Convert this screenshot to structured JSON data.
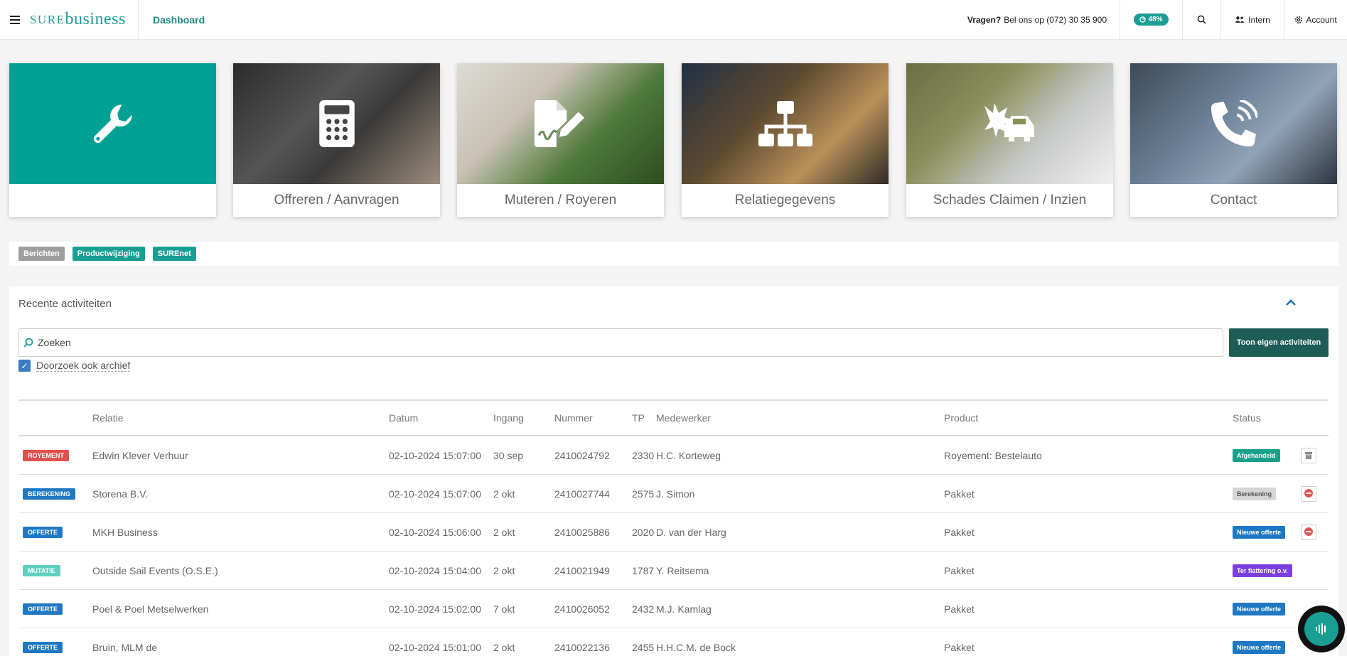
{
  "header": {
    "logo_sure": "SURE",
    "logo_business": "business",
    "breadcrumb": "Dashboard",
    "vragen_label": "Vragen?",
    "vragen_text": "Bel ons op (072) 30 35 900",
    "progress_badge": "48%",
    "intern_label": "Intern",
    "account_label": "Account"
  },
  "tiles": [
    {
      "label": "",
      "icon": "wrench-icon",
      "color": "#00a095"
    },
    {
      "label": "Offreren / Aanvragen",
      "icon": "calculator-icon"
    },
    {
      "label": "Muteren / Royeren",
      "icon": "file-signature-icon"
    },
    {
      "label": "Relatiegegevens",
      "icon": "network-icon"
    },
    {
      "label": "Schades Claimen / Inzien",
      "icon": "car-crash-icon"
    },
    {
      "label": "Contact",
      "icon": "phone-volume-icon"
    }
  ],
  "tags": [
    {
      "label": "Berichten",
      "color": "#9e9e9e"
    },
    {
      "label": "Productwijziging",
      "color": "#1a9e94"
    },
    {
      "label": "SUREnet",
      "color": "#1a9e94"
    }
  ],
  "activities": {
    "title": "Recente activiteiten",
    "search_placeholder": "Zoeken",
    "own_button": "Toon eigen activiteiten",
    "archive_label": "Doorzoek ook archief",
    "columns": [
      "Relatie",
      "Datum",
      "Ingang",
      "Nummer",
      "TP",
      "Medewerker",
      "Product",
      "Status"
    ],
    "rows": [
      {
        "type": "ROYEMENT",
        "type_color": "#e0504f",
        "relatie": "Edwin Klever Verhuur",
        "datum": "02-10-2024 15:07:00",
        "ingang": "30 sep",
        "nummer": "2410024792",
        "tp": "2330",
        "medewerker": "H.C. Korteweg",
        "product": "Royement: Bestelauto",
        "status": "Afgehandeld",
        "status_color": "#1aa08a",
        "status_text_color": "#ffffff",
        "action": "archive-icon"
      },
      {
        "type": "BEREKENING",
        "type_color": "#1f78c1",
        "relatie": "Storena B.V.",
        "datum": "02-10-2024 15:07:00",
        "ingang": "2 okt",
        "nummer": "2410027744",
        "tp": "2575",
        "medewerker": "J. Simon",
        "product": "Pakket",
        "status": "Berekening",
        "status_color": "#d6d6d6",
        "status_text_color": "#555555",
        "action": "remove-icon"
      },
      {
        "type": "OFFERTE",
        "type_color": "#1f78c1",
        "relatie": "MKH Business",
        "datum": "02-10-2024 15:06:00",
        "ingang": "2 okt",
        "nummer": "2410025886",
        "tp": "2020",
        "medewerker": "D. van der Harg",
        "product": "Pakket",
        "status": "Nieuwe offerte",
        "status_color": "#1f78c1",
        "status_text_color": "#ffffff",
        "action": "remove-icon"
      },
      {
        "type": "MUTATIE",
        "type_color": "#5fd0c0",
        "relatie": "Outside Sail Events (O.S.E.)",
        "datum": "02-10-2024 15:04:00",
        "ingang": "2 okt",
        "nummer": "2410021949",
        "tp": "1787",
        "medewerker": "Y. Reitsema",
        "product": "Pakket",
        "status": "Ter fiattering o.v.",
        "status_color": "#7b3fe0",
        "status_text_color": "#ffffff",
        "action": ""
      },
      {
        "type": "OFFERTE",
        "type_color": "#1f78c1",
        "relatie": "Poel & Poel Metselwerken",
        "datum": "02-10-2024 15:02:00",
        "ingang": "7 okt",
        "nummer": "2410026052",
        "tp": "2432",
        "medewerker": "M.J. Kamlag",
        "product": "Pakket",
        "status": "Nieuwe offerte",
        "status_color": "#1f78c1",
        "status_text_color": "#ffffff",
        "action": ""
      },
      {
        "type": "OFFERTE",
        "type_color": "#1f78c1",
        "relatie": "Bruin, MLM de",
        "datum": "02-10-2024 15:01:00",
        "ingang": "2 okt",
        "nummer": "2410022136",
        "tp": "2455",
        "medewerker": "H.H.C.M. de Bock",
        "product": "Pakket",
        "status": "Nieuwe offerte",
        "status_color": "#1f78c1",
        "status_text_color": "#ffffff",
        "action": ""
      }
    ]
  }
}
